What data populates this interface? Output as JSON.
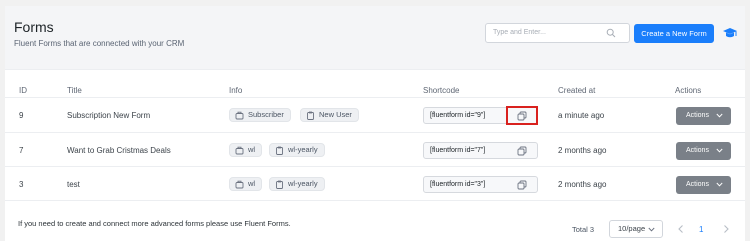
{
  "header": {
    "title": "Forms",
    "subtitle": "Fluent Forms that are connected with your CRM",
    "search_placeholder": "Type and Enter...",
    "create_label": "Create a New Form"
  },
  "table": {
    "columns": [
      "ID",
      "Title",
      "Info",
      "Shortcode",
      "Created at",
      "Actions"
    ],
    "rows": [
      {
        "id": "9",
        "title": "Subscription New Form",
        "info": [
          "Subscriber",
          "New User"
        ],
        "shortcode": "[fluentform id=\"9\"]",
        "created": "a minute ago",
        "action": "Actions"
      },
      {
        "id": "7",
        "title": "Want to Grab Cristmas Deals",
        "info": [
          "wl",
          "wl-yearly"
        ],
        "shortcode": "[fluentform id=\"7\"]",
        "created": "2 months ago",
        "action": "Actions"
      },
      {
        "id": "3",
        "title": "test",
        "info": [
          "wl",
          "wl-yearly"
        ],
        "shortcode": "[fluentform id=\"3\"]",
        "created": "2 months ago",
        "action": "Actions"
      }
    ]
  },
  "footer": {
    "note": "If you need to create and connect more advanced forms please use Fluent Forms.",
    "total": "Total 3",
    "per_page": "10/page",
    "current_page": "1"
  },
  "colors": {
    "primary": "#1a7efb",
    "action_button": "#7a8088",
    "highlight": "#d9211e"
  },
  "icons": [
    "search-icon",
    "graduation-cap-icon",
    "tag-icon",
    "clipboard-icon",
    "copy-icon",
    "chevron-down-icon",
    "chevron-left-icon",
    "chevron-right-icon"
  ]
}
